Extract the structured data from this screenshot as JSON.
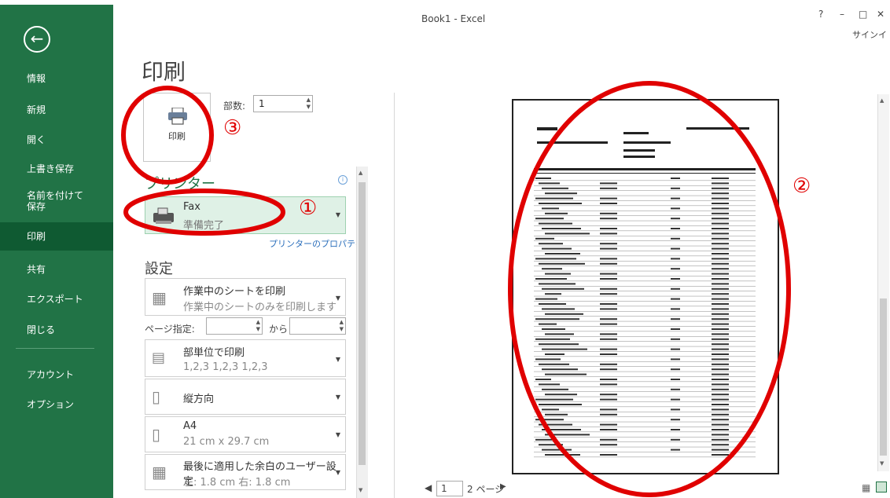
{
  "window": {
    "title": "Book1 - Excel",
    "help": "?",
    "minimize": "–",
    "restore": "□",
    "close": "✕",
    "signin": "サインイ"
  },
  "sidebar": {
    "back_icon": "back-arrow-icon",
    "items": [
      {
        "label": "情報"
      },
      {
        "label": "新規"
      },
      {
        "label": "開く"
      },
      {
        "label": "上書き保存"
      },
      {
        "label": "名前を付けて\n保存"
      },
      {
        "label": "印刷",
        "active": true
      },
      {
        "label": "共有"
      },
      {
        "label": "エクスポート"
      },
      {
        "label": "閉じる"
      },
      {
        "label": "アカウント"
      },
      {
        "label": "オプション"
      }
    ]
  },
  "main": {
    "title": "印刷",
    "print_button": "印刷",
    "copies_label": "部数:",
    "copies_value": "1",
    "printer_heading": "プリンター",
    "printer": {
      "name": "Fax",
      "status": "準備完了"
    },
    "printer_properties": "プリンターのプロパティ",
    "settings_heading": "設定",
    "settings": [
      {
        "line1": "作業中のシートを印刷",
        "line2": "作業中のシートのみを印刷します"
      },
      {
        "line1": "部単位で印刷",
        "line2": "1,2,3    1,2,3    1,2,3"
      },
      {
        "line1": "縦方向",
        "line2": ""
      },
      {
        "line1": "A4",
        "line2": "21 cm x 29.7 cm"
      },
      {
        "line1": "最後に適用した余白のユーザー設定",
        "line2": "左: 1.8 cm   右: 1.8 cm"
      }
    ],
    "pages_label": "ページ指定:",
    "pages_to": "から"
  },
  "preview": {
    "page_input": "1",
    "page_total": "2 ページ"
  },
  "annotations": {
    "one": "①",
    "two": "②",
    "three": "③",
    "color": "#e00000"
  },
  "colors": {
    "accent": "#217346"
  }
}
